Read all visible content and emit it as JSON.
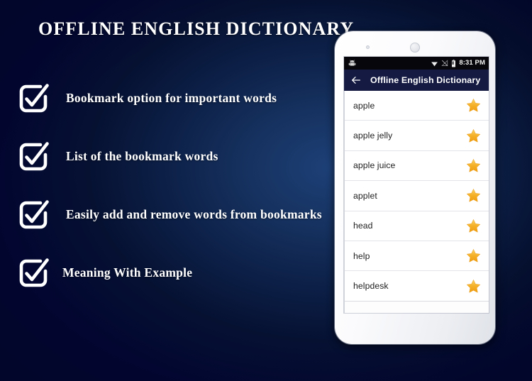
{
  "promo": {
    "headline": "OFFLINE ENGLISH DICTIONARY",
    "background_color": "#020833",
    "accent_color": "#1d4077",
    "features": [
      {
        "icon": "checkbox-checked-icon",
        "label": "Bookmark option for important words"
      },
      {
        "icon": "checkbox-checked-icon",
        "label": "List of the bookmark words"
      },
      {
        "icon": "checkbox-checked-icon",
        "label": "Easily add and remove words from bookmarks"
      },
      {
        "icon": "checkbox-checked-icon",
        "label": " Meaning With Example"
      }
    ]
  },
  "phone": {
    "status_bar": {
      "notification_icon": "android-robot-icon",
      "icons": [
        "wifi-icon",
        "signal-off-icon",
        "battery-icon"
      ],
      "time": "8:31 PM",
      "background_color": "#07070b"
    },
    "app_bar": {
      "back_icon": "back-arrow-icon",
      "title": "Offline English Dictionary",
      "background_color": "#141a42"
    },
    "word_list": [
      {
        "word": "apple",
        "icon": "star-icon",
        "starred": true
      },
      {
        "word": "apple jelly",
        "icon": "star-icon",
        "starred": true
      },
      {
        "word": "apple juice",
        "icon": "star-icon",
        "starred": true
      },
      {
        "word": "applet",
        "icon": "star-icon",
        "starred": true
      },
      {
        "word": "head",
        "icon": "star-icon",
        "starred": true
      },
      {
        "word": "help",
        "icon": "star-icon",
        "starred": true
      },
      {
        "word": "helpdesk",
        "icon": "star-icon",
        "starred": true
      }
    ],
    "star_color": "#f2a81d"
  }
}
